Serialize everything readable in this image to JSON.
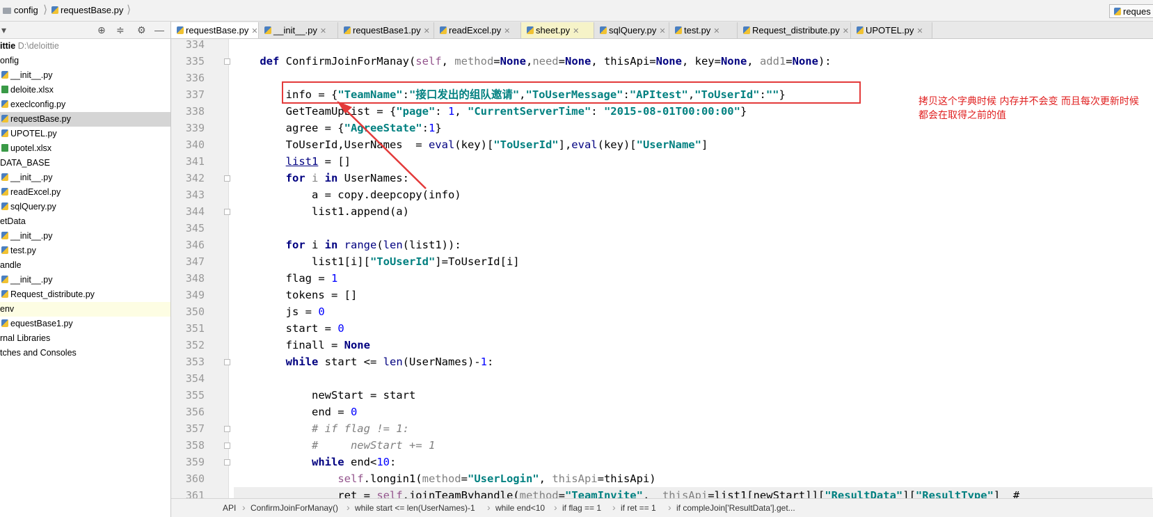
{
  "breadcrumb": {
    "items": [
      "config",
      "requestBase.py"
    ]
  },
  "run_config": {
    "label": "reques"
  },
  "sidebar": {
    "project": {
      "name": "ittie",
      "path": "D:\\deloittie"
    },
    "items": [
      {
        "label": "onfig",
        "type": "dir"
      },
      {
        "label": "__init__.py",
        "type": "py"
      },
      {
        "label": "deloite.xlsx",
        "type": "xls"
      },
      {
        "label": "execlconfig.py",
        "type": "py"
      },
      {
        "label": "requestBase.py",
        "type": "py"
      },
      {
        "label": "UPOTEL.py",
        "type": "py"
      },
      {
        "label": "upotel.xlsx",
        "type": "xls"
      },
      {
        "label": "DATA_BASE",
        "type": "dir"
      },
      {
        "label": "__init__.py",
        "type": "py"
      },
      {
        "label": "readExcel.py",
        "type": "py"
      },
      {
        "label": "sqlQuery.py",
        "type": "py"
      },
      {
        "label": "etData",
        "type": "dir"
      },
      {
        "label": "__init__.py",
        "type": "py"
      },
      {
        "label": "test.py",
        "type": "py"
      },
      {
        "label": "andle",
        "type": "dir"
      },
      {
        "label": "__init__.py",
        "type": "py"
      },
      {
        "label": "Request_distribute.py",
        "type": "py"
      },
      {
        "label": "env",
        "type": "dir"
      },
      {
        "label": "equestBase1.py",
        "type": "py"
      },
      {
        "label": "rnal Libraries",
        "type": "dir"
      },
      {
        "label": "tches and Consoles",
        "type": "dir"
      }
    ]
  },
  "tabs": [
    {
      "label": "requestBase.py"
    },
    {
      "label": "__init__.py"
    },
    {
      "label": "requestBase1.py"
    },
    {
      "label": "readExcel.py"
    },
    {
      "label": "sheet.py"
    },
    {
      "label": "sqlQuery.py"
    },
    {
      "label": "test.py"
    },
    {
      "label": "Request_distribute.py"
    },
    {
      "label": "UPOTEL.py"
    }
  ],
  "editor": {
    "line_numbers": [
      "334",
      "335",
      "336",
      "337",
      "338",
      "339",
      "340",
      "341",
      "342",
      "343",
      "344",
      "345",
      "346",
      "347",
      "348",
      "349",
      "350",
      "351",
      "352",
      "353",
      "354",
      "355",
      "356",
      "357",
      "358",
      "359",
      "360",
      "361"
    ],
    "lines": [
      [],
      [
        [
          "kw",
          "    def "
        ],
        [
          "",
          "ConfirmJoinForManay("
        ],
        [
          "sf",
          "self"
        ],
        [
          "",
          ", "
        ],
        [
          "pm",
          "method"
        ],
        [
          "",
          "="
        ],
        [
          "kw",
          "None"
        ],
        [
          "",
          ","
        ],
        [
          "pm",
          "need"
        ],
        [
          "",
          "="
        ],
        [
          "kw",
          "None"
        ],
        [
          "",
          ", thisApi="
        ],
        [
          "kw",
          "None"
        ],
        [
          "",
          ", key="
        ],
        [
          "kw",
          "None"
        ],
        [
          "",
          ", "
        ],
        [
          "pm",
          "add1"
        ],
        [
          "",
          "="
        ],
        [
          "kw",
          "None"
        ],
        [
          "",
          "):"
        ]
      ],
      [],
      [
        [
          "",
          "        info = {"
        ],
        [
          "st",
          "\"TeamName\""
        ],
        [
          "",
          ":"
        ],
        [
          "st",
          "\"接口发出的组队邀请\""
        ],
        [
          "",
          ","
        ],
        [
          "st",
          "\"ToUserMessage\""
        ],
        [
          "",
          ":"
        ],
        [
          "st",
          "\"APItest\""
        ],
        [
          "",
          ","
        ],
        [
          "st",
          "\"ToUserId\""
        ],
        [
          "",
          ":"
        ],
        [
          "st",
          "\"\""
        ],
        [
          "",
          "}"
        ]
      ],
      [
        [
          "",
          "        GetTeamUpList = {"
        ],
        [
          "st",
          "\"page\""
        ],
        [
          "",
          ": "
        ],
        [
          "nm",
          "1"
        ],
        [
          "",
          ", "
        ],
        [
          "st",
          "\"CurrentServerTime\""
        ],
        [
          "",
          ": "
        ],
        [
          "st",
          "\"2015-08-01T00:00:00\""
        ],
        [
          "",
          "}"
        ]
      ],
      [
        [
          "",
          "        agree = {"
        ],
        [
          "st",
          "\"AgreeState\""
        ],
        [
          "",
          ":"
        ],
        [
          "nm",
          "1"
        ],
        [
          "",
          "}"
        ]
      ],
      [
        [
          "",
          "        ToUserId,UserNames  = "
        ],
        [
          "bi",
          "eval"
        ],
        [
          "",
          "(key)["
        ],
        [
          "st",
          "\"ToUserId\""
        ],
        [
          "",
          "],"
        ],
        [
          "bi",
          "eval"
        ],
        [
          "",
          "(key)["
        ],
        [
          "st",
          "\"UserName\""
        ],
        [
          "",
          "]"
        ]
      ],
      [
        [
          "",
          "        "
        ],
        [
          "un",
          "list1"
        ],
        [
          "",
          " = []"
        ]
      ],
      [
        [
          "kw",
          "        for "
        ],
        [
          "pm",
          "i"
        ],
        [
          "kw",
          " in "
        ],
        [
          "",
          "UserNames:"
        ]
      ],
      [
        [
          "",
          "            a = copy.deepcopy(info)"
        ]
      ],
      [
        [
          "",
          "            list1.append(a)"
        ]
      ],
      [],
      [
        [
          "kw",
          "        for "
        ],
        [
          "",
          "i "
        ],
        [
          "kw",
          "in "
        ],
        [
          "bi",
          "range"
        ],
        [
          "",
          "("
        ],
        [
          "bi",
          "len"
        ],
        [
          "",
          "(list1)):"
        ]
      ],
      [
        [
          "",
          "            list1[i]["
        ],
        [
          "st",
          "\"ToUserId\""
        ],
        [
          "",
          "]=ToUserId[i]"
        ]
      ],
      [
        [
          "",
          "        flag = "
        ],
        [
          "nm",
          "1"
        ]
      ],
      [
        [
          "",
          "        tokens = []"
        ]
      ],
      [
        [
          "",
          "        js = "
        ],
        [
          "nm",
          "0"
        ]
      ],
      [
        [
          "",
          "        start = "
        ],
        [
          "nm",
          "0"
        ]
      ],
      [
        [
          "",
          "        finall = "
        ],
        [
          "kw",
          "None"
        ]
      ],
      [
        [
          "kw",
          "        while "
        ],
        [
          "",
          "start <= "
        ],
        [
          "bi",
          "len"
        ],
        [
          "",
          "(UserNames)-"
        ],
        [
          "nm",
          "1"
        ],
        [
          "",
          ":"
        ]
      ],
      [],
      [
        [
          "",
          "            newStart = start"
        ]
      ],
      [
        [
          "",
          "            end = "
        ],
        [
          "nm",
          "0"
        ]
      ],
      [
        [
          "cm",
          "            # if flag != 1:"
        ]
      ],
      [
        [
          "cm",
          "            #     newStart += 1"
        ]
      ],
      [
        [
          "kw",
          "            while "
        ],
        [
          "",
          "end<"
        ],
        [
          "nm",
          "10"
        ],
        [
          "",
          ":"
        ]
      ],
      [
        [
          "",
          "                "
        ],
        [
          "sf",
          "self"
        ],
        [
          "",
          ".longin1("
        ],
        [
          "pm",
          "method"
        ],
        [
          "",
          "="
        ],
        [
          "st",
          "\"UserLogin\""
        ],
        [
          "",
          ", "
        ],
        [
          "pm",
          "thisApi"
        ],
        [
          "",
          "=thisApi)"
        ]
      ],
      [
        [
          "",
          "                ret = "
        ],
        [
          "sf",
          "self"
        ],
        [
          "",
          ".joinTeamByhandle("
        ],
        [
          "pm",
          "method"
        ],
        [
          "",
          "="
        ],
        [
          "st",
          "\"TeamInvite\""
        ],
        [
          "",
          ",  "
        ],
        [
          "pm",
          "thisApi"
        ],
        [
          "",
          "=list1[newStart]]["
        ],
        [
          "st",
          "\"ResultData\""
        ],
        [
          "",
          "]["
        ],
        [
          "st",
          "\"ResultType\""
        ],
        [
          "",
          "]  #"
        ]
      ]
    ]
  },
  "annotation": {
    "text": "拷贝这个字典时候 内存并不会变 而且每次更新时候 都会在取得之前的值"
  },
  "status_bar": {
    "items": [
      "API",
      "ConfirmJoinForManay()",
      "while start <= len(UserNames)-1",
      "while end<10",
      "if flag == 1",
      "if ret == 1",
      "if compleJoin['ResultData'].get..."
    ]
  },
  "colors": {
    "annotation": "#e02020",
    "keyword": "#000080",
    "string": "#008080",
    "number": "#0000ff"
  }
}
